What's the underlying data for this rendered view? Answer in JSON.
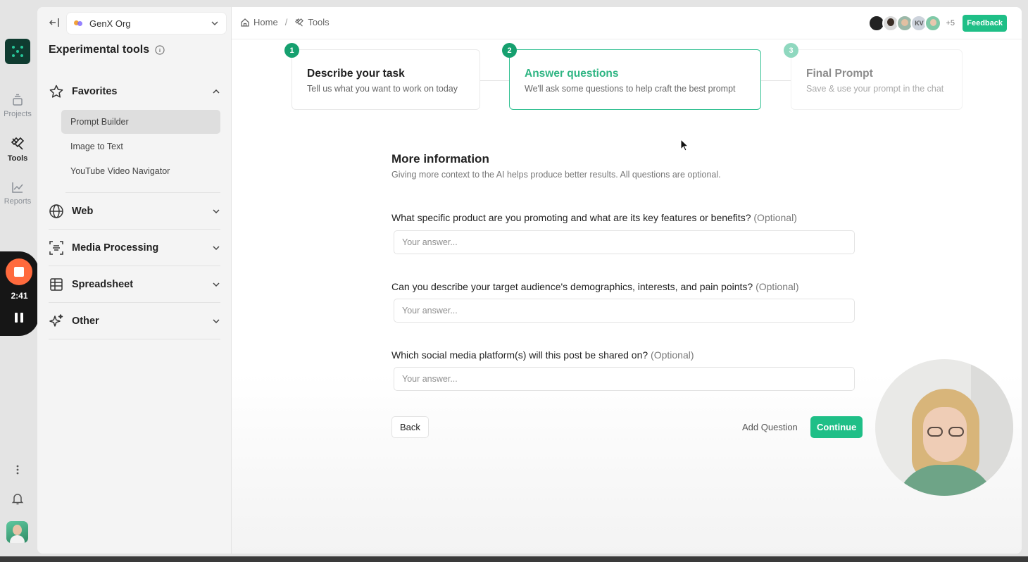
{
  "rail": {
    "projects_label": "Projects",
    "tools_label": "Tools",
    "reports_label": "Reports",
    "recording_time": "2:41"
  },
  "sidebar": {
    "org_name": "GenX Org",
    "title": "Experimental tools",
    "groups": [
      {
        "label": "Favorites",
        "icon": "star-icon",
        "expanded": true,
        "items": [
          "Prompt Builder",
          "Image to Text",
          "YouTube Video Navigator"
        ]
      },
      {
        "label": "Web",
        "icon": "globe-icon",
        "expanded": false
      },
      {
        "label": "Media Processing",
        "icon": "media-icon",
        "expanded": false
      },
      {
        "label": "Spreadsheet",
        "icon": "table-icon",
        "expanded": false
      },
      {
        "label": "Other",
        "icon": "sparkle-icon",
        "expanded": false
      }
    ],
    "active_item": "Prompt Builder"
  },
  "header": {
    "breadcrumbs": [
      "Home",
      "Tools"
    ],
    "avatar_initials": "KV",
    "more_count": "+5",
    "feedback_label": "Feedback"
  },
  "steps": [
    {
      "num": "1",
      "title": "Describe your task",
      "desc": "Tell us what you want to work on today",
      "state": "done"
    },
    {
      "num": "2",
      "title": "Answer questions",
      "desc": "We'll ask some questions to help craft the best prompt",
      "state": "active"
    },
    {
      "num": "3",
      "title": "Final Prompt",
      "desc": "Save & use your prompt in the chat",
      "state": "upcoming"
    }
  ],
  "form": {
    "title": "More information",
    "subtitle": "Giving more context to the AI helps produce better results. All questions are optional.",
    "optional_tag": "(Optional)",
    "questions": [
      {
        "label": "What specific product are you promoting and what are its key features or benefits?",
        "placeholder": "Your answer...",
        "value": ""
      },
      {
        "label": "Can you describe your target audience's demographics, interests, and pain points?",
        "placeholder": "Your answer...",
        "value": ""
      },
      {
        "label": "Which social media platform(s) will this post be shared on?",
        "placeholder": "Your answer...",
        "value": ""
      }
    ],
    "back_label": "Back",
    "add_question_label": "Add Question",
    "continue_label": "Continue"
  },
  "colors": {
    "accent": "#1fbf87",
    "accent_dark": "#16a06f",
    "logo_bg": "#0f3b30",
    "record": "#ff6a3d"
  }
}
